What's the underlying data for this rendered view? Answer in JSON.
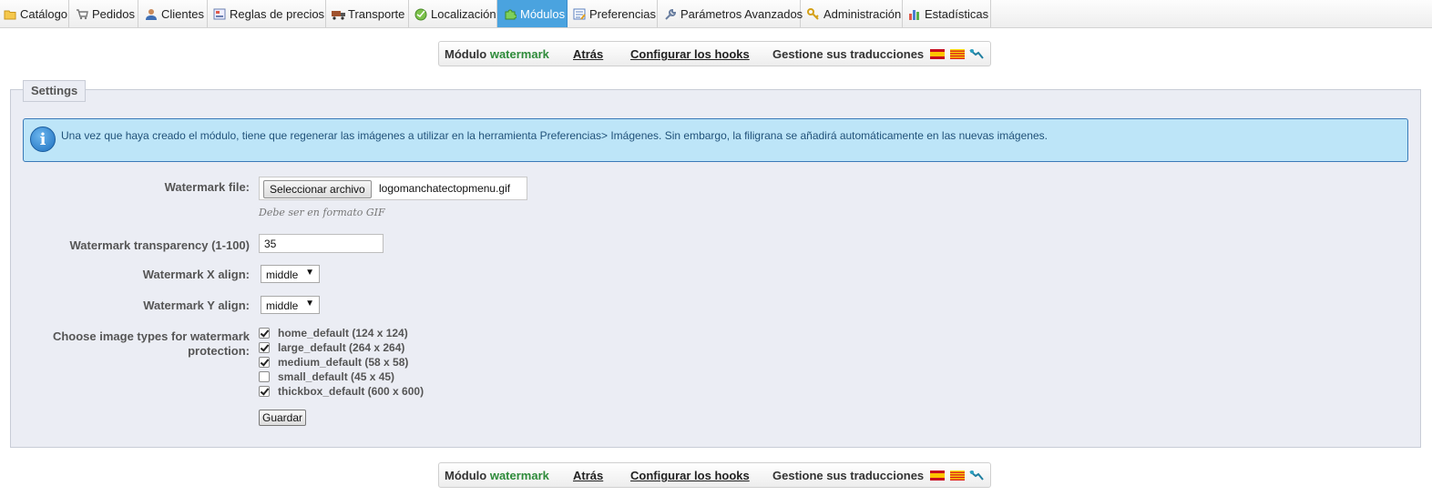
{
  "nav": {
    "tabs": [
      {
        "label": "Catálogo",
        "icon": "folder-icon"
      },
      {
        "label": "Pedidos",
        "icon": "cart-icon"
      },
      {
        "label": "Clientes",
        "icon": "user-icon"
      },
      {
        "label": "Reglas de precios",
        "icon": "price-rules-icon"
      },
      {
        "label": "Transporte",
        "icon": "truck-icon"
      },
      {
        "label": "Localización",
        "icon": "globe-icon"
      },
      {
        "label": "Módulos",
        "icon": "puzzle-icon",
        "active": true
      },
      {
        "label": "Preferencias",
        "icon": "preferences-icon"
      },
      {
        "label": "Parámetros Avanzados",
        "icon": "wrench-icon"
      },
      {
        "label": "Administración",
        "icon": "key-icon"
      },
      {
        "label": "Estadísticas",
        "icon": "stats-icon"
      }
    ]
  },
  "module_bar": {
    "module_label": "Módulo",
    "module_name": "watermark",
    "back_link": "Atrás",
    "hooks_link": "Configurar los hooks",
    "translations_label": "Gestione sus traducciones",
    "flags": [
      "spain-flag-icon",
      "catalonia-flag-icon",
      "edit-translation-icon"
    ]
  },
  "settings": {
    "legend": "Settings",
    "info": "Una vez que haya creado el módulo, tiene que regenerar las imágenes a utilizar en la herramienta Preferencias> Imágenes. Sin embargo, la filigrana se añadirá automáticamente en las nuevas imágenes.",
    "file": {
      "label": "Watermark file:",
      "button": "Seleccionar archivo",
      "filename": "logomanchatectopmenu.gif",
      "hint": "Debe ser en formato GIF"
    },
    "transparency": {
      "label": "Watermark transparency (1-100)",
      "value": "35"
    },
    "x_align": {
      "label": "Watermark X align:",
      "value": "middle"
    },
    "y_align": {
      "label": "Watermark Y align:",
      "value": "middle"
    },
    "image_types": {
      "label_line1": "Choose image types for watermark",
      "label_line2": "protection:",
      "items": [
        {
          "label": "home_default (124 x 124)",
          "checked": true
        },
        {
          "label": "large_default (264 x 264)",
          "checked": true
        },
        {
          "label": "medium_default (58 x 58)",
          "checked": true
        },
        {
          "label": "small_default (45 x 45)",
          "checked": false
        },
        {
          "label": "thickbox_default (600 x 600)",
          "checked": true
        }
      ]
    },
    "save_button": "Guardar"
  },
  "colors": {
    "active_tab": "#4aa3df",
    "info_bg": "#bde5f8",
    "module_name": "#2e8b3a",
    "panel_bg": "#ebedf4"
  }
}
